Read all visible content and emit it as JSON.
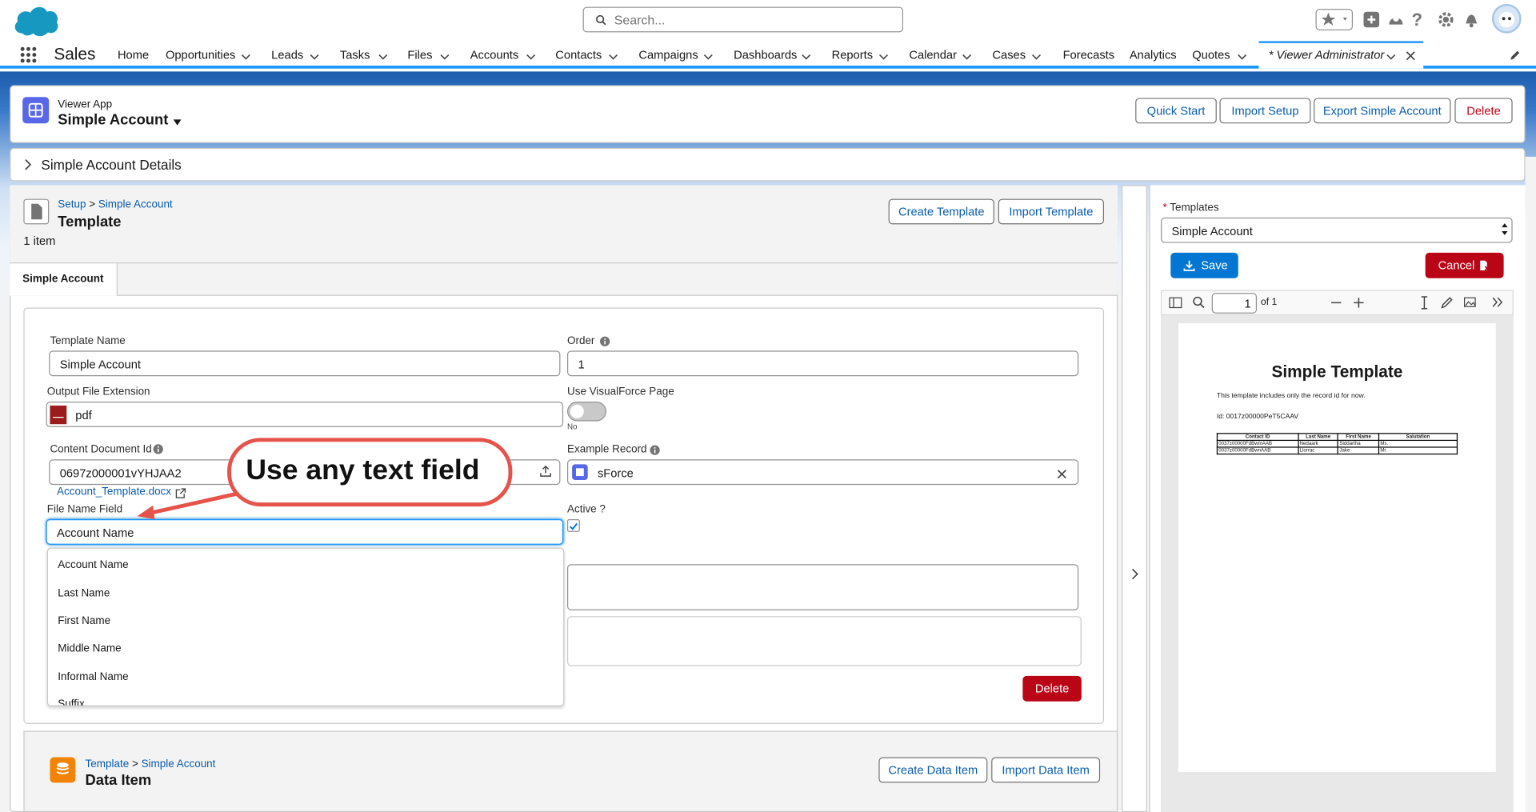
{
  "header": {
    "search_placeholder": "Search...",
    "app_name": "Sales"
  },
  "nav": {
    "items": [
      "Home",
      "Opportunities",
      "Leads",
      "Tasks",
      "Files",
      "Accounts",
      "Contacts",
      "Campaigns",
      "Dashboards",
      "Reports",
      "Calendar",
      "Cases",
      "Forecasts",
      "Analytics",
      "Quotes"
    ],
    "active_tab": "* Viewer Administrator"
  },
  "page_header": {
    "object_label": "Viewer App",
    "title": "Simple Account",
    "buttons": [
      "Quick Start",
      "Import Setup",
      "Export Simple Account",
      "Delete"
    ]
  },
  "details": {
    "label": "Simple Account Details"
  },
  "template_section": {
    "breadcrumb_setup": "Setup",
    "breadcrumb_sep": ">",
    "breadcrumb_current": "Simple Account",
    "title": "Template",
    "count": "1 item",
    "buttons": [
      "Create Template",
      "Import Template"
    ],
    "tab": "Simple Account"
  },
  "form": {
    "template_name_label": "Template Name",
    "template_name_value": "Simple Account",
    "order_label": "Order",
    "order_value": "1",
    "output_ext_label": "Output File Extension",
    "output_ext_value": "pdf",
    "visualforce_label": "Use VisualForce Page",
    "visualforce_state": "No",
    "content_doc_label": "Content Document Id",
    "content_doc_value": "0697z000001vYHJAA2",
    "content_doc_link": "Account_Template.docx",
    "example_record_label": "Example Record",
    "example_record_value": "sForce",
    "file_name_label": "File Name Field",
    "file_name_value": "Account Name",
    "active_label": "Active ?",
    "active_checked": true,
    "delete_label": "Delete",
    "dropdown_options": [
      "Account Name",
      "Last Name",
      "First Name",
      "Middle Name",
      "Informal Name",
      "Suffix"
    ]
  },
  "callout": {
    "text": "Use any text field"
  },
  "data_item_section": {
    "breadcrumb_parent": "Template",
    "breadcrumb_sep": ">",
    "breadcrumb_current": "Simple Account",
    "title": "Data Item",
    "buttons": [
      "Create Data Item",
      "Import Data Item"
    ]
  },
  "preview": {
    "templates_label": "Templates",
    "templates_value": "Simple Account",
    "save_label": "Save",
    "cancel_label": "Cancel",
    "page_number": "1",
    "page_of": "of 1",
    "doc_title": "Simple Template",
    "doc_text": "This template includes only the record id for now.",
    "doc_id_line": "Id:  0017z00000PeT5CAAV",
    "doc_table_headers": [
      "Contact ID",
      "Last Name",
      "First Name",
      "Salutation"
    ],
    "doc_table_rows": [
      [
        "0037z00000FdBwmAAB",
        "Nedaark",
        "Siddartha",
        "Ms."
      ],
      [
        "0037z00000FdBwnAAB",
        "Llorrac",
        "Jake",
        "Mr."
      ]
    ]
  },
  "colors": {
    "brand_blue": "#0176d3",
    "danger_red": "#ba0517",
    "callout_red": "#e5534b"
  }
}
